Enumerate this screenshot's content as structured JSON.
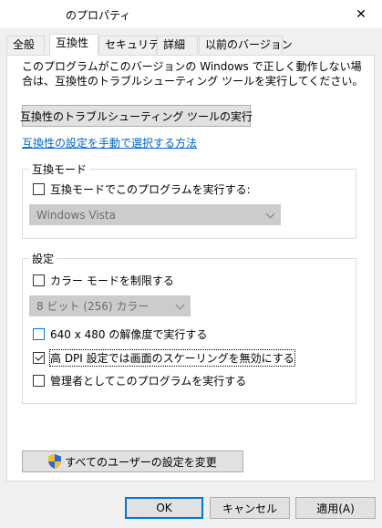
{
  "window": {
    "title": "のプロパティ",
    "close_glyph": "✕"
  },
  "tabs": [
    {
      "label": "全般"
    },
    {
      "label": "互換性"
    },
    {
      "label": "セキュリティ"
    },
    {
      "label": "詳細"
    },
    {
      "label": "以前のバージョン"
    }
  ],
  "active_tab": "互換性",
  "compat": {
    "description": "このプログラムがこのバージョンの Windows で正しく動作しない場合は、互換性のトラブルシューティング ツールを実行してください。",
    "troubleshooter_button": "互換性のトラブルシューティング ツールの実行",
    "manual_link": "互換性の設定を手動で選択する方法",
    "mode_group": {
      "label": "互換モード",
      "checkbox_label": "互換モードでこのプログラムを実行する:",
      "checked": false,
      "dropdown_value": "Windows Vista"
    },
    "settings_group": {
      "label": "設定",
      "color_mode_label": "カラー モードを制限する",
      "color_mode_checked": false,
      "color_dropdown_value": "8 ビット (256) カラー",
      "resolution_label": "640 x 480 の解像度で実行する",
      "resolution_checked": false,
      "dpi_label": "高 DPI 設定では画面のスケーリングを無効にする",
      "dpi_checked": true,
      "admin_label": "管理者としてこのプログラムを実行する",
      "admin_checked": false
    },
    "all_users_button": "すべてのユーザーの設定を変更"
  },
  "footer": {
    "ok": "OK",
    "cancel": "キャンセル",
    "apply": "適用(A)"
  },
  "icons": {
    "close": "close-icon",
    "shield": "uac-shield-icon",
    "chevron": "chevron-down-icon",
    "check": "checkmark-icon"
  },
  "colors": {
    "primary_border": "#0078d7",
    "link": "#0066cc",
    "disabled_dropdown_bg": "#cccccc",
    "panel_bg": "#ffffff",
    "dialog_bg": "#f0f0f0"
  }
}
